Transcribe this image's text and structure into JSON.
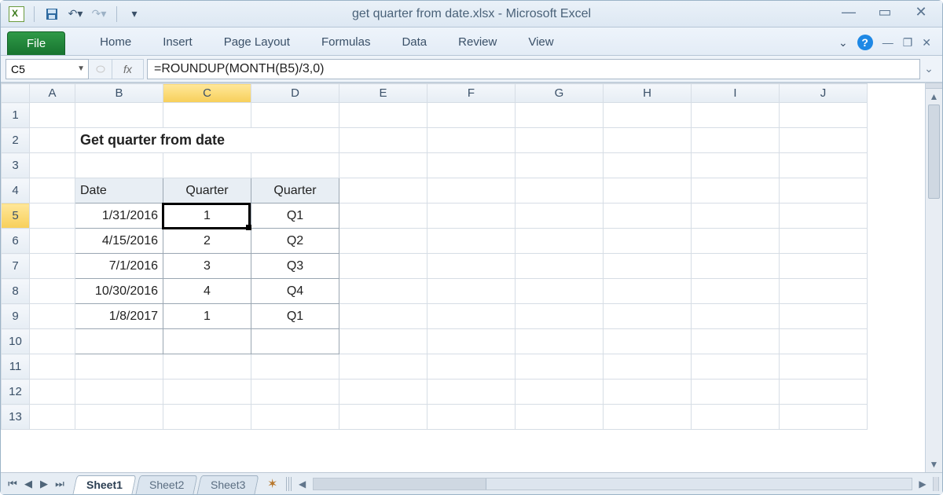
{
  "window": {
    "title": "get quarter from date.xlsx  -  Microsoft Excel"
  },
  "ribbon": {
    "file": "File",
    "tabs": [
      "Home",
      "Insert",
      "Page Layout",
      "Formulas",
      "Data",
      "Review",
      "View"
    ]
  },
  "namebox": "C5",
  "fx_label": "fx",
  "formula": "=ROUNDUP(MONTH(B5)/3,0)",
  "columns": [
    "A",
    "B",
    "C",
    "D",
    "E",
    "F",
    "G",
    "H",
    "I",
    "J"
  ],
  "rows": [
    "1",
    "2",
    "3",
    "4",
    "5",
    "6",
    "7",
    "8",
    "9",
    "10",
    "11",
    "12",
    "13"
  ],
  "content": {
    "title_cell": "Get quarter from date",
    "headers": {
      "b4": "Date",
      "c4": "Quarter",
      "d4": "Quarter"
    },
    "data": [
      {
        "date": "1/31/2016",
        "q": "1",
        "qlabel": "Q1"
      },
      {
        "date": "4/15/2016",
        "q": "2",
        "qlabel": "Q2"
      },
      {
        "date": "7/1/2016",
        "q": "3",
        "qlabel": "Q3"
      },
      {
        "date": "10/30/2016",
        "q": "4",
        "qlabel": "Q4"
      },
      {
        "date": "1/8/2017",
        "q": "1",
        "qlabel": "Q1"
      }
    ]
  },
  "sheets": {
    "active": "Sheet1",
    "others": [
      "Sheet2",
      "Sheet3"
    ]
  },
  "active_cell": {
    "ref": "C5"
  }
}
